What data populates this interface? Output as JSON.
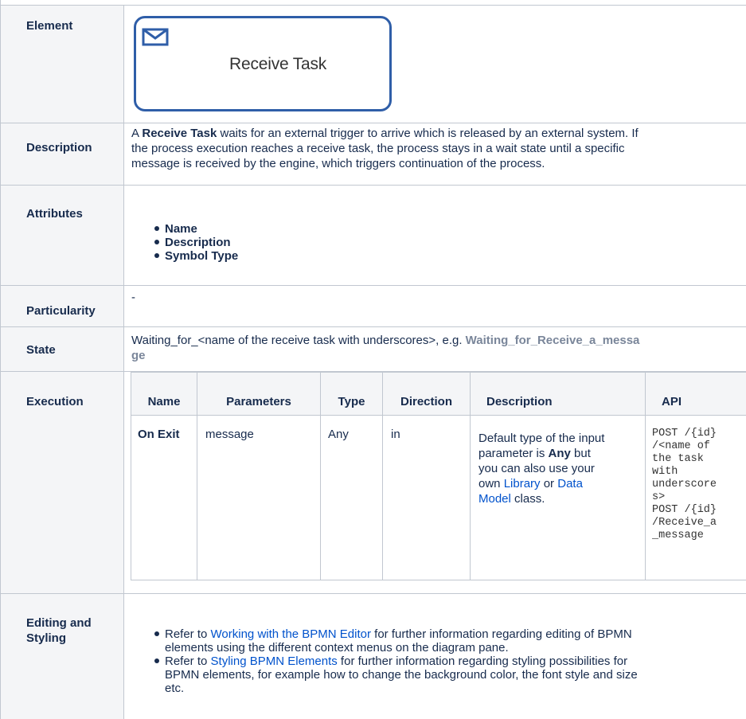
{
  "element": {
    "header": "Element",
    "task_label": "Receive Task",
    "task_icon": "envelope-icon",
    "border_color": "#2f5ea8"
  },
  "description": {
    "header": "Description",
    "text_intro": "A ",
    "text_bold": "Receive Task",
    "line1": " waits for an external trigger to arrive which is released by an external system. If",
    "line2": "the process execution reaches a receive task, the process stays in a wait state until a specific",
    "line3": "message is received by the engine, which triggers continuation of the process."
  },
  "attributes": {
    "header": "Attributes",
    "items": [
      "Name",
      "Description",
      "Symbol Type"
    ]
  },
  "particularity": {
    "header": "Particularity",
    "value": "-"
  },
  "state": {
    "header": "State",
    "text": "Waiting_for_<name of the receive task with underscores>, e.g. ",
    "example_line1": "Waiting_for_Receive_a_messa",
    "example_line2": "ge"
  },
  "execution": {
    "header": "Execution",
    "columns": [
      "Name",
      "Parameters",
      "Type",
      "Direction",
      "Description",
      "API"
    ],
    "row": {
      "name": "On Exit",
      "parameters": "message",
      "type": "Any",
      "direction": "in",
      "desc_line1": "Default type of the input",
      "desc_line2a": "parameter is ",
      "desc_line2b": "Any",
      "desc_line2c": " but",
      "desc_line3": "you can also use your",
      "desc_line4a": "own ",
      "desc_library": "Library",
      "desc_or": " or ",
      "desc_data": "Data",
      "desc_model": "Model",
      "desc_class": " class.",
      "api": "POST /{id}\n/<name of\nthe task\nwith\nunderscore\ns>\nPOST /{id}\n/Receive_a\n_message"
    }
  },
  "editing": {
    "header_line1": "Editing and",
    "header_line2": "Styling",
    "item1_pre": "Refer to ",
    "item1_link": "Working with the BPMN Editor",
    "item1_post": " for further information regarding editing of BPMN",
    "item1_line2": "elements using the different context menus on the diagram pane.",
    "item2_pre": "Refer to ",
    "item2_link": "Styling BPMN Elements",
    "item2_post": " for further information regarding styling possibilities for",
    "item2_line2": "BPMN elements, for example how to change the background color, the font style and size",
    "item2_line3": "etc."
  }
}
